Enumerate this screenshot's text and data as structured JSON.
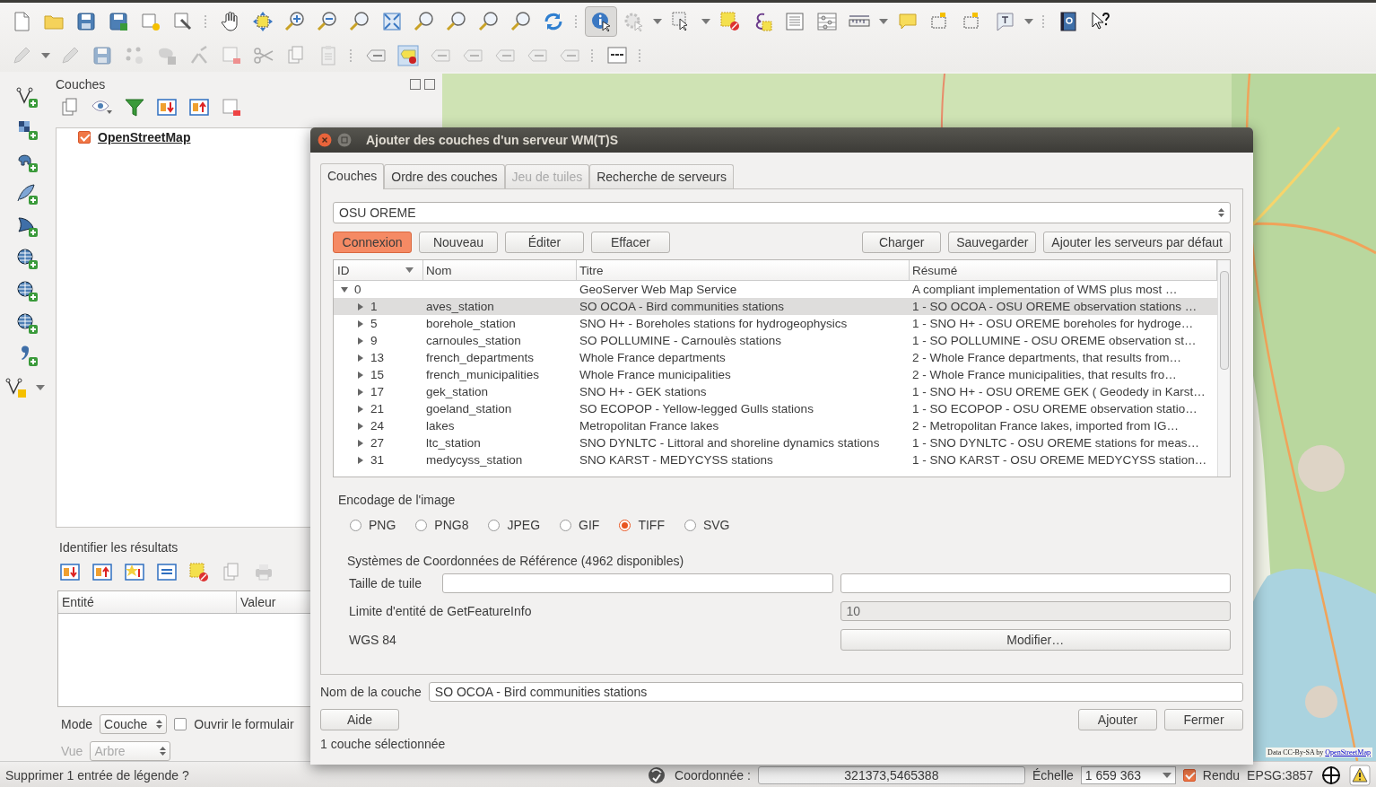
{
  "layers_panel": {
    "title": "Couches",
    "layers": [
      {
        "name": "OpenStreetMap",
        "checked": true
      }
    ]
  },
  "identify_panel": {
    "title": "Identifier les résultats",
    "columns": [
      "Entité",
      "Valeur"
    ],
    "mode": {
      "label": "Mode",
      "value": "Couche"
    },
    "open_form": {
      "label": "Ouvrir le formulair",
      "checked": false
    },
    "view": {
      "label": "Vue",
      "value": "Arbre",
      "disabled": true
    }
  },
  "map": {
    "kind": "picture",
    "attribution": "Data CC-By-SA by",
    "attribution_link": "OpenStreetMap"
  },
  "dialog": {
    "title": "Ajouter des couches d'un serveur WM(T)S",
    "tabs": [
      {
        "label": "Couches",
        "selected": true,
        "disabled": false
      },
      {
        "label": "Ordre des couches",
        "selected": false,
        "disabled": false
      },
      {
        "label": "Jeu de tuiles",
        "selected": false,
        "disabled": true
      },
      {
        "label": "Recherche de serveurs",
        "selected": false,
        "disabled": false
      }
    ],
    "server": "OSU OREME",
    "buttons_left": [
      {
        "label": "Connexion",
        "highlighted": true
      },
      {
        "label": "Nouveau",
        "highlighted": false
      },
      {
        "label": "Éditer",
        "highlighted": false
      },
      {
        "label": "Effacer",
        "highlighted": false
      }
    ],
    "buttons_right": [
      "Charger",
      "Sauvegarder",
      "Ajouter les serveurs par défaut"
    ],
    "table": {
      "columns": [
        "ID",
        "Nom",
        "Titre",
        "Résumé"
      ],
      "rows": [
        {
          "id": "0",
          "name": "",
          "title": "GeoServer Web Map Service",
          "summary": "A compliant implementation of WMS plus most …",
          "expanded": true,
          "selected": false,
          "children": [
            {
              "id": "1",
              "name": "aves_station",
              "title": "SO OCOA - Bird communities stations",
              "summary": "1 - SO OCOA - OSU OREME observation stations …",
              "expanded": false,
              "selected": true
            },
            {
              "id": "5",
              "name": "borehole_station",
              "title": "SNO H+ - Boreholes stations for hydrogeophysics",
              "summary": "1 - SNO H+ - OSU OREME boreholes for hydroge…",
              "expanded": false,
              "selected": false
            },
            {
              "id": "9",
              "name": "carnoules_station",
              "title": "SO POLLUMINE - Carnoulès stations",
              "summary": "1 - SO POLLUMINE - OSU OREME observation st…",
              "expanded": false,
              "selected": false
            },
            {
              "id": "13",
              "name": "french_departments",
              "title": "Whole France departments",
              "summary": "2 - Whole France departments, that results from…",
              "expanded": false,
              "selected": false
            },
            {
              "id": "15",
              "name": "french_municipalities",
              "title": "Whole France municipalities",
              "summary": "2 - Whole France municipalities, that results fro…",
              "expanded": false,
              "selected": false
            },
            {
              "id": "17",
              "name": "gek_station",
              "title": "SNO H+ - GEK stations",
              "summary": "1 - SNO H+ - OSU OREME GEK ( Geodedy in Karst…",
              "expanded": false,
              "selected": false
            },
            {
              "id": "21",
              "name": "goeland_station",
              "title": "SO ECOPOP - Yellow-legged Gulls stations",
              "summary": "1 - SO ECOPOP - OSU OREME observation statio…",
              "expanded": false,
              "selected": false
            },
            {
              "id": "24",
              "name": "lakes",
              "title": "Metropolitan France lakes",
              "summary": "2 - Metropolitan France lakes, imported from IG…",
              "expanded": false,
              "selected": false
            },
            {
              "id": "27",
              "name": "ltc_station",
              "title": "SNO DYNLTC - Littoral and shoreline dynamics stations",
              "summary": "1 - SNO DYNLTC - OSU OREME stations for meas…",
              "expanded": false,
              "selected": false
            },
            {
              "id": "31",
              "name": "medycyss_station",
              "title": "SNO KARST - MEDYCYSS stations",
              "summary": "1 - SNO KARST - OSU OREME MEDYCYSS station…",
              "expanded": false,
              "selected": false
            }
          ]
        }
      ]
    },
    "encoding": {
      "title": "Encodage de l'image",
      "formats": [
        {
          "label": "PNG",
          "selected": false
        },
        {
          "label": "PNG8",
          "selected": false
        },
        {
          "label": "JPEG",
          "selected": false
        },
        {
          "label": "GIF",
          "selected": false
        },
        {
          "label": "TIFF",
          "selected": true
        },
        {
          "label": "SVG",
          "selected": false
        }
      ]
    },
    "crs_title": "Systèmes de Coordonnées de Référence (4962 disponibles)",
    "tile_size_label": "Taille de tuile",
    "feature_limit": {
      "label": "Limite d'entité de GetFeatureInfo",
      "value": "10",
      "disabled": true
    },
    "crs_name": "WGS 84",
    "modify_button": "Modifier…",
    "layer_name_label": "Nom de la couche",
    "layer_name": "SO OCOA - Bird communities stations",
    "help_button": "Aide",
    "add_button": "Ajouter",
    "close_button": "Fermer",
    "status": "1 couche sélectionnée"
  },
  "status_bar": {
    "message": "Supprimer 1 entrée de légende ?",
    "coordinate_label": "Coordonnée :",
    "coordinate": "321373,5465388",
    "scale_label": "Échelle",
    "scale": "1 659 363",
    "render": {
      "label": "Rendu",
      "checked": true
    },
    "crs": "EPSG:3857"
  }
}
